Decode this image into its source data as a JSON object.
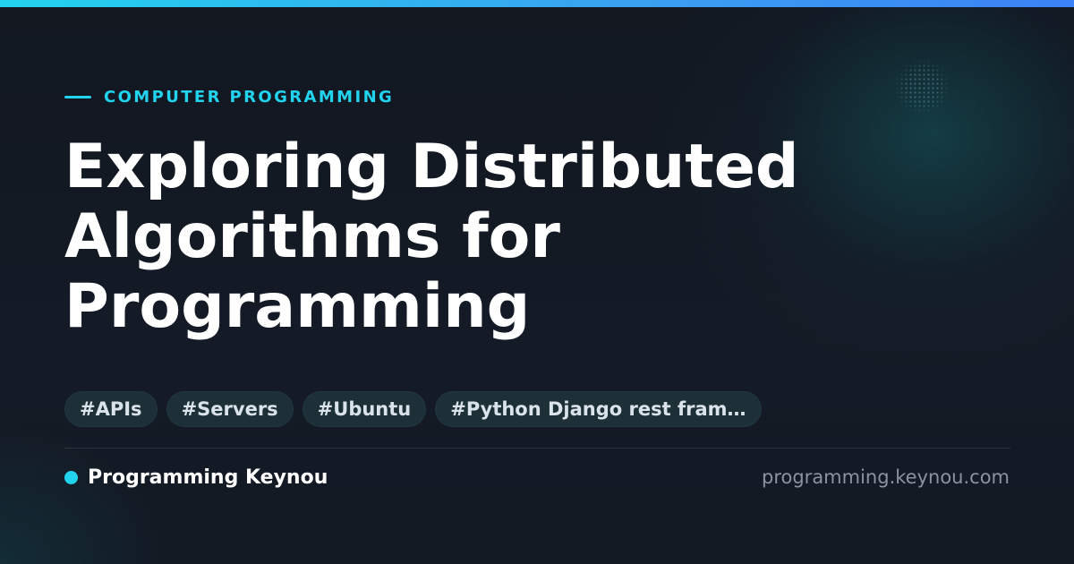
{
  "category": "COMPUTER PROGRAMMING",
  "title": "Exploring Distributed Algorithms for Programming",
  "tags": [
    "#APIs",
    "#Servers",
    "#Ubuntu",
    "#Python Django rest fram…"
  ],
  "footer": {
    "brand": "Programming Keynou",
    "url": "programming.keynou.com"
  },
  "colors": {
    "accent": "#22d3ee",
    "background": "#121821",
    "tag_background": "#1d3038"
  }
}
